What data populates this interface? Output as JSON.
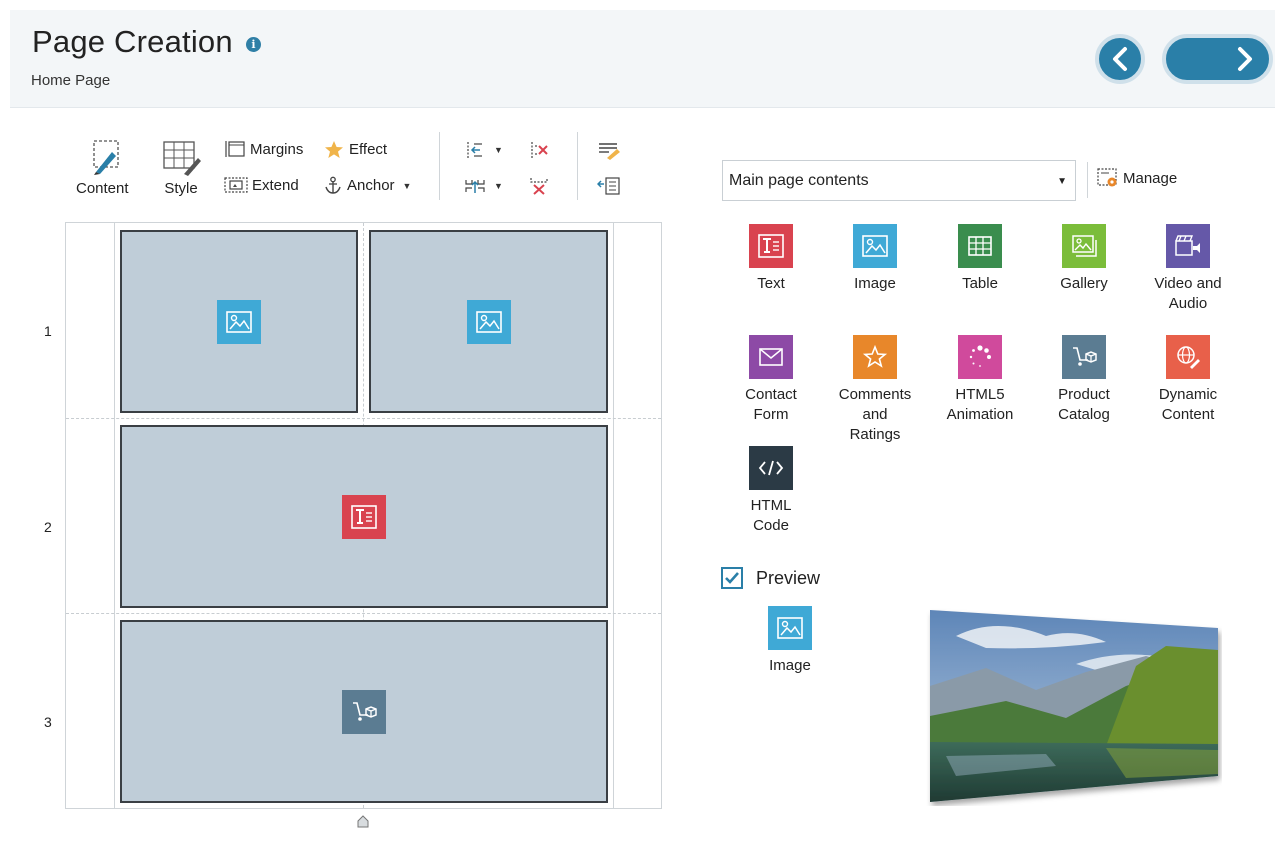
{
  "header": {
    "title": "Page Creation",
    "info_icon": "info-icon",
    "subtitle": "Home Page",
    "back_icon": "chevron-left-icon",
    "next_icon": "chevron-right-icon"
  },
  "toolbar": {
    "content_label": "Content",
    "style_label": "Style",
    "margins_label": "Margins",
    "extend_label": "Extend",
    "effect_label": "Effect",
    "anchor_label": "Anchor"
  },
  "layout": {
    "rows": [
      "1",
      "2",
      "3"
    ],
    "cells": [
      {
        "name": "cell-row1-left",
        "icon": "image-icon"
      },
      {
        "name": "cell-row1-right",
        "icon": "image-icon"
      },
      {
        "name": "cell-row2",
        "icon": "text-icon"
      },
      {
        "name": "cell-row3",
        "icon": "product-catalog-icon"
      }
    ]
  },
  "panel": {
    "select_value": "Main page contents",
    "manage_label": "Manage",
    "objects": [
      {
        "label": "Text",
        "icon": "text-icon",
        "color": "#d9434f"
      },
      {
        "label": "Image",
        "icon": "image-icon",
        "color": "#3fa9d6"
      },
      {
        "label": "Table",
        "icon": "table-icon",
        "color": "#3a8d4e"
      },
      {
        "label": "Gallery",
        "icon": "gallery-icon",
        "color": "#7bbd3a"
      },
      {
        "label": "Video and\nAudio",
        "icon": "video-icon",
        "color": "#6558a8"
      },
      {
        "label": "Contact\nForm",
        "icon": "envelope-icon",
        "color": "#8d4aa6"
      },
      {
        "label": "Comments\nand\nRatings",
        "icon": "star-icon",
        "color": "#e8872a"
      },
      {
        "label": "HTML5\nAnimation",
        "icon": "animation-icon",
        "color": "#d04a9c"
      },
      {
        "label": "Product\nCatalog",
        "icon": "product-catalog-icon",
        "color": "#5b7c92"
      },
      {
        "label": "Dynamic\nContent",
        "icon": "dynamic-content-icon",
        "color": "#e8604a"
      },
      {
        "label": "HTML\nCode",
        "icon": "code-icon",
        "color": "#2b3a45"
      }
    ],
    "preview_label": "Preview",
    "preview_checked": true,
    "preview_object_label": "Image"
  }
}
